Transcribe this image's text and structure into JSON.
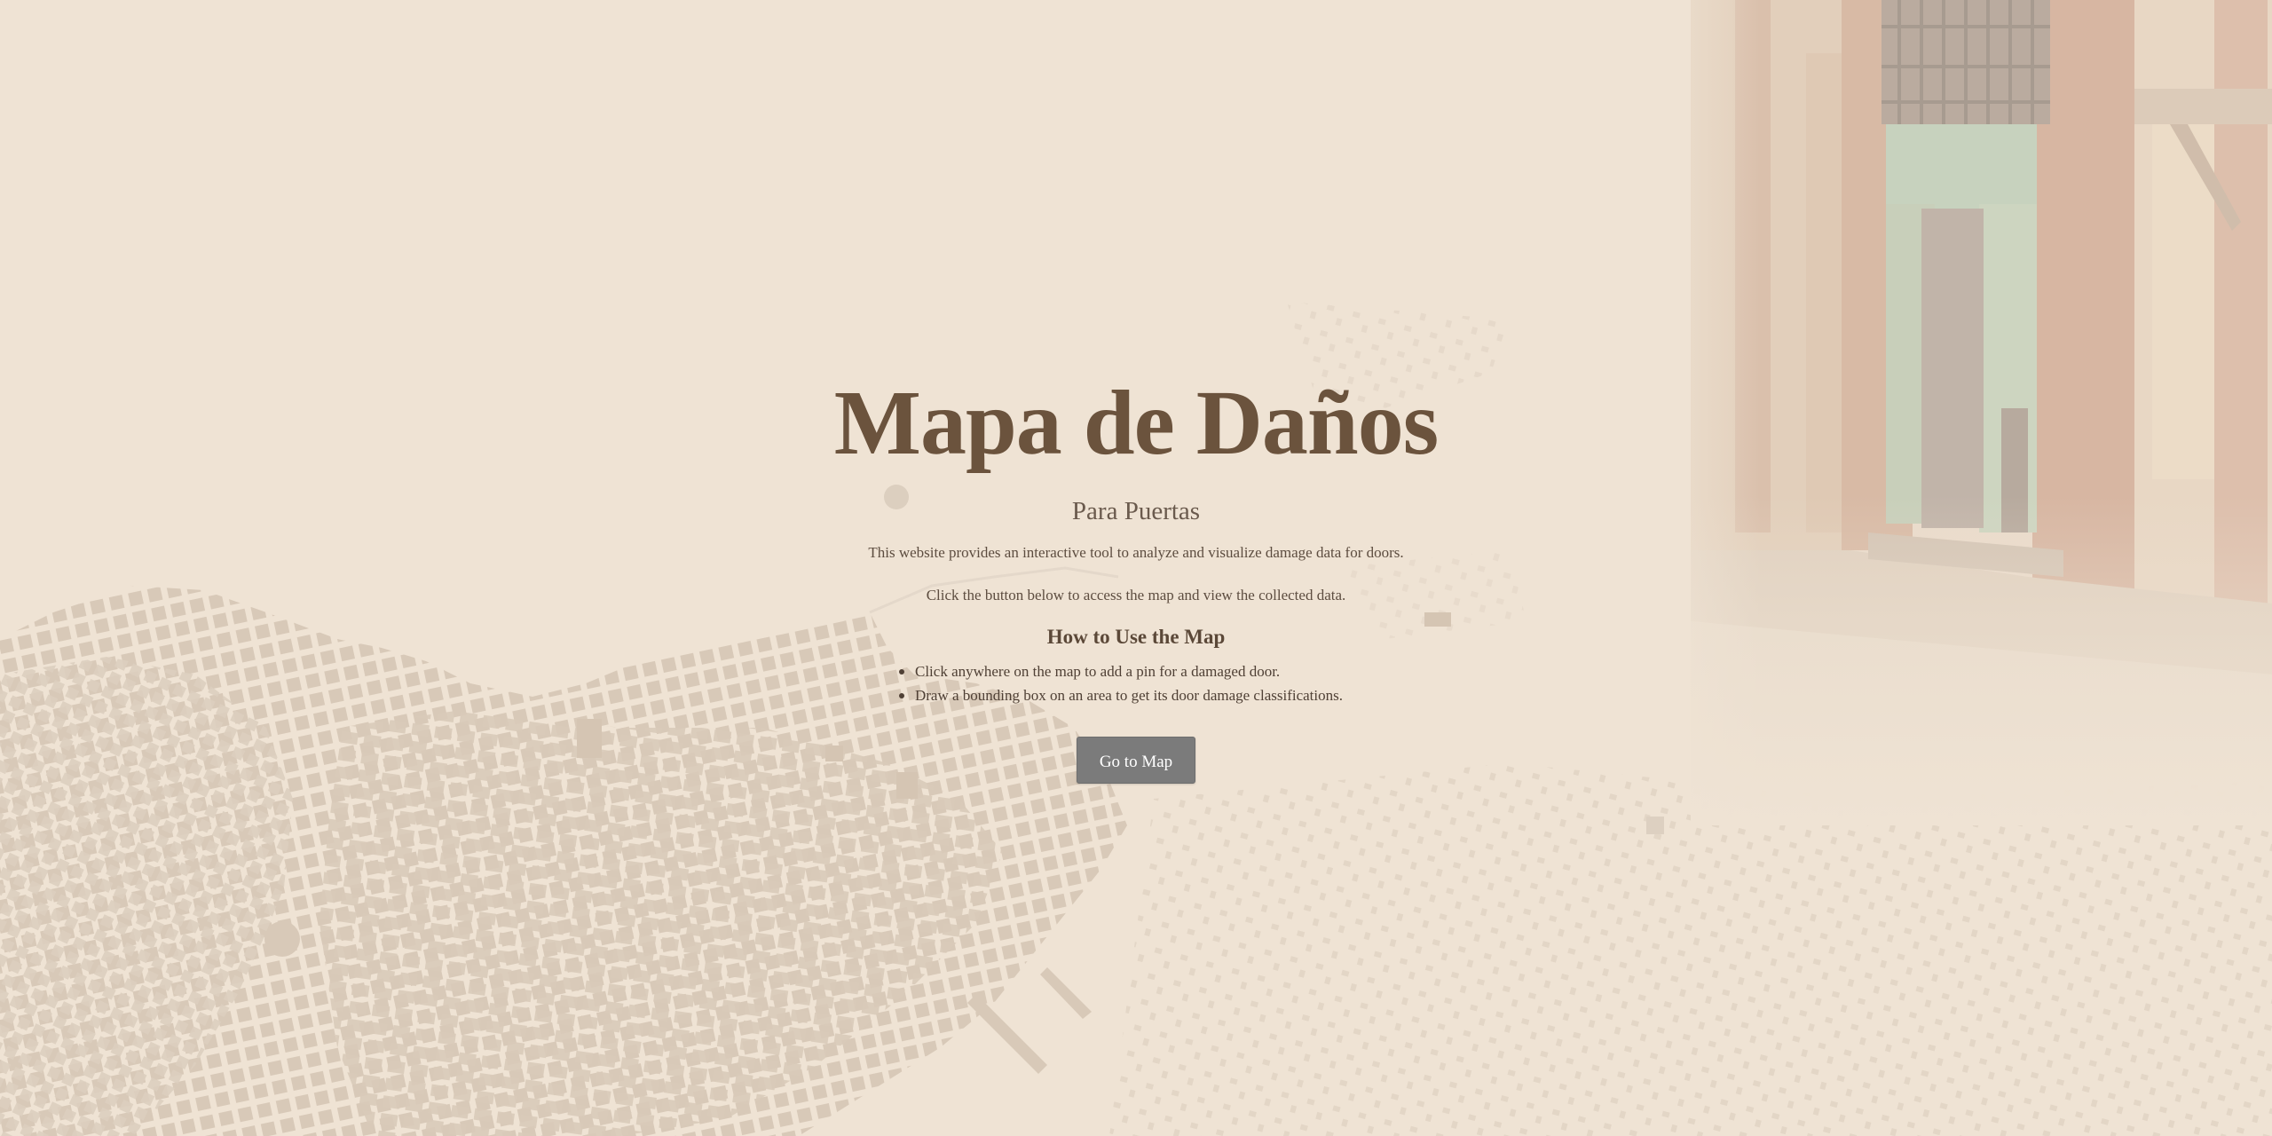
{
  "page": {
    "title": "Mapa de Daños",
    "subtitle": "Para Puertas",
    "description": "This website provides an interactive tool to analyze and visualize damage data for doors.",
    "instruction": "Click the button below to access the map and view the collected data.",
    "howto": {
      "heading": "How to Use the Map",
      "steps": [
        "Click anywhere on the map to add a pin for a damaged door.",
        "Draw a bounding box on an area to get its door damage classifications."
      ]
    },
    "button_label": "Go to Map"
  },
  "colors": {
    "background": "#efe3d4",
    "title": "#6b533d",
    "button": "#7b7b7b",
    "map_blocks": "#d9cbbb"
  },
  "icons": {
    "background_map": "city-map-illustration",
    "background_photo": "weathered-doorway-photo"
  }
}
